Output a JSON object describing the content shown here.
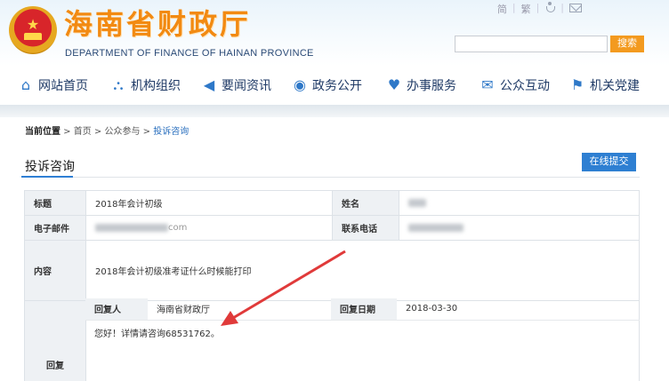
{
  "header": {
    "title": "海南省财政厅",
    "subtitle": "DEPARTMENT OF FINANCE OF HAINAN PROVINCE",
    "toplinks": {
      "simplified": "简",
      "traditional": "繁"
    },
    "search": {
      "placeholder": "",
      "button": "搜索"
    }
  },
  "nav": [
    {
      "label": "网站首页",
      "icon": "home-icon"
    },
    {
      "label": "机构组织",
      "icon": "org-chart-icon"
    },
    {
      "label": "要闻资讯",
      "icon": "megaphone-icon"
    },
    {
      "label": "政务公开",
      "icon": "eye-icon"
    },
    {
      "label": "办事服务",
      "icon": "heart-icon"
    },
    {
      "label": "公众互动",
      "icon": "chat-icon"
    },
    {
      "label": "机关党建",
      "icon": "flag-icon"
    }
  ],
  "breadcrumb": {
    "prefix": "当前位置",
    "items": [
      "首页",
      "公众参与",
      "投诉咨询"
    ]
  },
  "section": {
    "title": "投诉咨询",
    "action": "在线提交"
  },
  "form": {
    "title_label": "标题",
    "title_value": "2018年会计初级",
    "name_label": "姓名",
    "email_label": "电子邮件",
    "email_visible_fragment": "com",
    "phone_label": "联系电话",
    "content_label": "内容",
    "content_value": "2018年会计初级准考证什么时候能打印",
    "reply_label": "回复"
  },
  "reply": {
    "replier_label": "回复人",
    "replier_value": "海南省财政厅",
    "date_label": "回复日期",
    "date_value": "2018-03-30",
    "message": "您好！详情请咨询68531762。"
  },
  "colors": {
    "accent": "#2e7fd2",
    "brand": "#f28a12",
    "arrow": "#e03a3a"
  }
}
